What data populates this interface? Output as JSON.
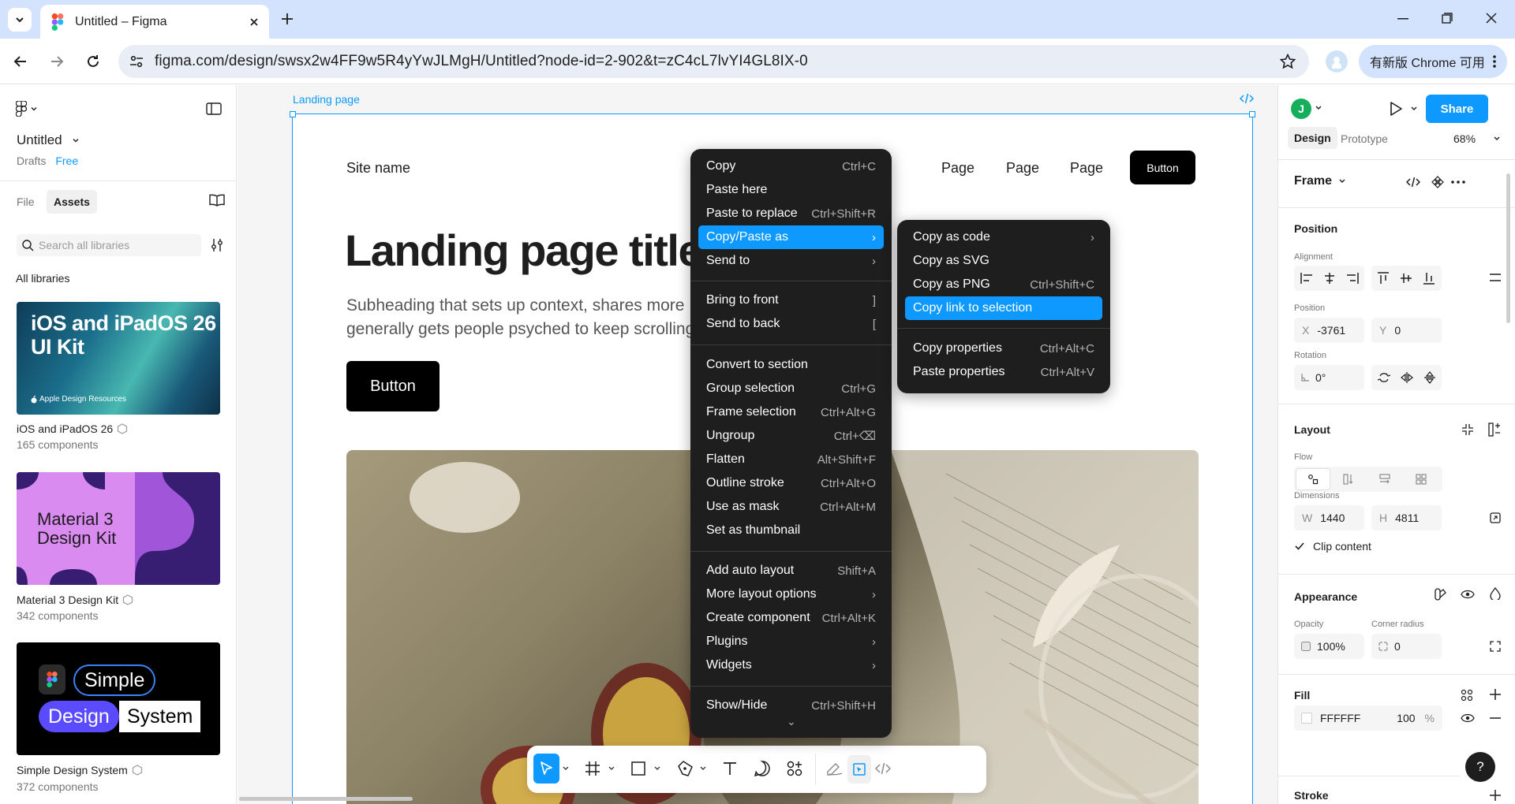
{
  "browser": {
    "tab_title": "Untitled – Figma",
    "url": "figma.com/design/swsx2w4FF9w5R4yYwJLMgH/Untitled?node-id=2-902&t=zC4cL7lvYI4GL8IX-0",
    "promo": "有新版 Chrome 可用"
  },
  "left_panel": {
    "file_title": "Untitled",
    "drafts": "Drafts",
    "plan": "Free",
    "tab_file": "File",
    "tab_assets": "Assets",
    "search_placeholder": "Search all libraries",
    "all_libraries": "All libraries",
    "libraries": [
      {
        "name": "iOS and iPadOS 26",
        "count": "165 components",
        "cover_line1": "iOS and iPadOS 26",
        "cover_line2": "UI Kit",
        "cover_footer": "Apple Design Resources"
      },
      {
        "name": "Material 3 Design Kit",
        "count": "342 components",
        "cover_line1": "Material 3",
        "cover_line2": "Design Kit"
      },
      {
        "name": "Simple Design System",
        "count": "372 components",
        "cover_w1": "Simple",
        "cover_w2": "Design",
        "cover_w3": "System"
      }
    ]
  },
  "canvas": {
    "frame_label": "Landing page",
    "site_name": "Site name",
    "nav": [
      "Page",
      "Page",
      "Page"
    ],
    "nav_button": "Button",
    "hero_title": "Landing page title",
    "hero_sub_1": "Subheading that sets up context, shares more",
    "hero_sub_2": "generally gets people psyched to keep scrolling",
    "hero_button": "Button"
  },
  "context_menu": {
    "items": [
      {
        "label": "Copy",
        "shortcut": "Ctrl+C"
      },
      {
        "label": "Paste here",
        "shortcut": ""
      },
      {
        "label": "Paste to replace",
        "shortcut": "Ctrl+Shift+R"
      },
      {
        "label": "Copy/Paste as",
        "shortcut": "›"
      },
      {
        "label": "Send to",
        "shortcut": "›"
      },
      {
        "label": "Bring to front",
        "shortcut": "]"
      },
      {
        "label": "Send to back",
        "shortcut": "["
      },
      {
        "label": "Convert to section",
        "shortcut": ""
      },
      {
        "label": "Group selection",
        "shortcut": "Ctrl+G"
      },
      {
        "label": "Frame selection",
        "shortcut": "Ctrl+Alt+G"
      },
      {
        "label": "Ungroup",
        "shortcut": "Ctrl+⌫"
      },
      {
        "label": "Flatten",
        "shortcut": "Alt+Shift+F"
      },
      {
        "label": "Outline stroke",
        "shortcut": "Ctrl+Alt+O"
      },
      {
        "label": "Use as mask",
        "shortcut": "Ctrl+Alt+M"
      },
      {
        "label": "Set as thumbnail",
        "shortcut": ""
      },
      {
        "label": "Add auto layout",
        "shortcut": "Shift+A"
      },
      {
        "label": "More layout options",
        "shortcut": "›"
      },
      {
        "label": "Create component",
        "shortcut": "Ctrl+Alt+K"
      },
      {
        "label": "Plugins",
        "shortcut": "›"
      },
      {
        "label": "Widgets",
        "shortcut": "›"
      },
      {
        "label": "Show/Hide",
        "shortcut": "Ctrl+Shift+H"
      }
    ],
    "more_indicator": "⌄"
  },
  "submenu": {
    "items": [
      {
        "label": "Copy as code",
        "shortcut": "›"
      },
      {
        "label": "Copy as SVG",
        "shortcut": ""
      },
      {
        "label": "Copy as PNG",
        "shortcut": "Ctrl+Shift+C"
      },
      {
        "label": "Copy link to selection",
        "shortcut": ""
      },
      {
        "label": "Copy properties",
        "shortcut": "Ctrl+Alt+C"
      },
      {
        "label": "Paste properties",
        "shortcut": "Ctrl+Alt+V"
      }
    ]
  },
  "right_panel": {
    "avatar_letter": "J",
    "share": "Share",
    "tab_design": "Design",
    "tab_prototype": "Prototype",
    "zoom": "68%",
    "frame_type": "Frame",
    "position_title": "Position",
    "alignment_label": "Alignment",
    "position_label": "Position",
    "x_prefix": "X",
    "x_value": "-3761",
    "y_prefix": "Y",
    "y_value": "0",
    "rotation_label": "Rotation",
    "rotation_value": "0°",
    "layout_title": "Layout",
    "flow_label": "Flow",
    "dimensions_label": "Dimensions",
    "w_prefix": "W",
    "w_value": "1440",
    "h_prefix": "H",
    "h_value": "4811",
    "clip_content": "Clip content",
    "appearance_title": "Appearance",
    "opacity_label": "Opacity",
    "opacity_value": "100%",
    "corner_label": "Corner radius",
    "corner_value": "0",
    "fill_title": "Fill",
    "fill_hex": "FFFFFF",
    "fill_opacity": "100",
    "fill_pct": "%",
    "stroke_title": "Stroke",
    "help": "?"
  },
  "colors": {
    "accent": "#0d99ff",
    "share_button": "#0d99ff",
    "avatar": "#14ae5c",
    "menu_bg": "#1e1e1e",
    "tab_bar": "#d3e3fd"
  }
}
